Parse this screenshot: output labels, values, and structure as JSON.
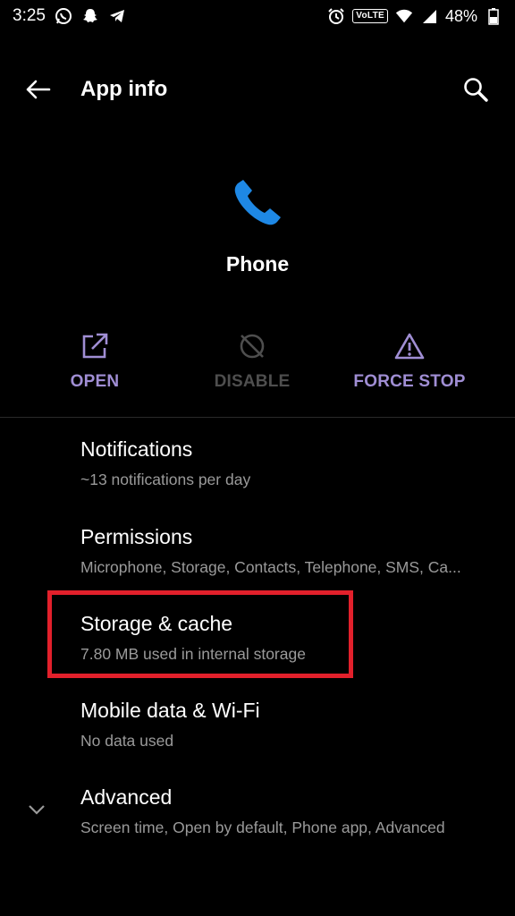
{
  "status_bar": {
    "time": "3:25",
    "left_icons": [
      "whatsapp-icon",
      "snapchat-icon",
      "telegram-icon"
    ],
    "right_icons": [
      "alarm-icon",
      "volte-badge",
      "wifi-icon",
      "signal-icon",
      "battery-icon"
    ],
    "volte_label": "VoLTE",
    "battery_percent": "48%"
  },
  "toolbar": {
    "title": "App info"
  },
  "app": {
    "name": "Phone",
    "icon_color": "#1e88e5"
  },
  "actions": [
    {
      "label": "OPEN",
      "icon": "open-external-icon",
      "enabled": true
    },
    {
      "label": "DISABLE",
      "icon": "disable-icon",
      "enabled": false
    },
    {
      "label": "FORCE STOP",
      "icon": "warning-icon",
      "enabled": true
    }
  ],
  "settings": [
    {
      "title": "Notifications",
      "subtitle": "~13 notifications per day"
    },
    {
      "title": "Permissions",
      "subtitle": "Microphone, Storage, Contacts, Telephone, SMS, Ca..."
    },
    {
      "title": "Storage & cache",
      "subtitle": "7.80 MB used in internal storage"
    },
    {
      "title": "Mobile data & Wi-Fi",
      "subtitle": "No data used"
    },
    {
      "title": "Advanced",
      "subtitle": "Screen time, Open by default, Phone app, Advanced"
    }
  ],
  "colors": {
    "background": "#000000",
    "accent": "#a08ed4",
    "disabled": "#4e4e4e",
    "highlight": "#e2202b",
    "subtitle": "#9a9a9a"
  }
}
